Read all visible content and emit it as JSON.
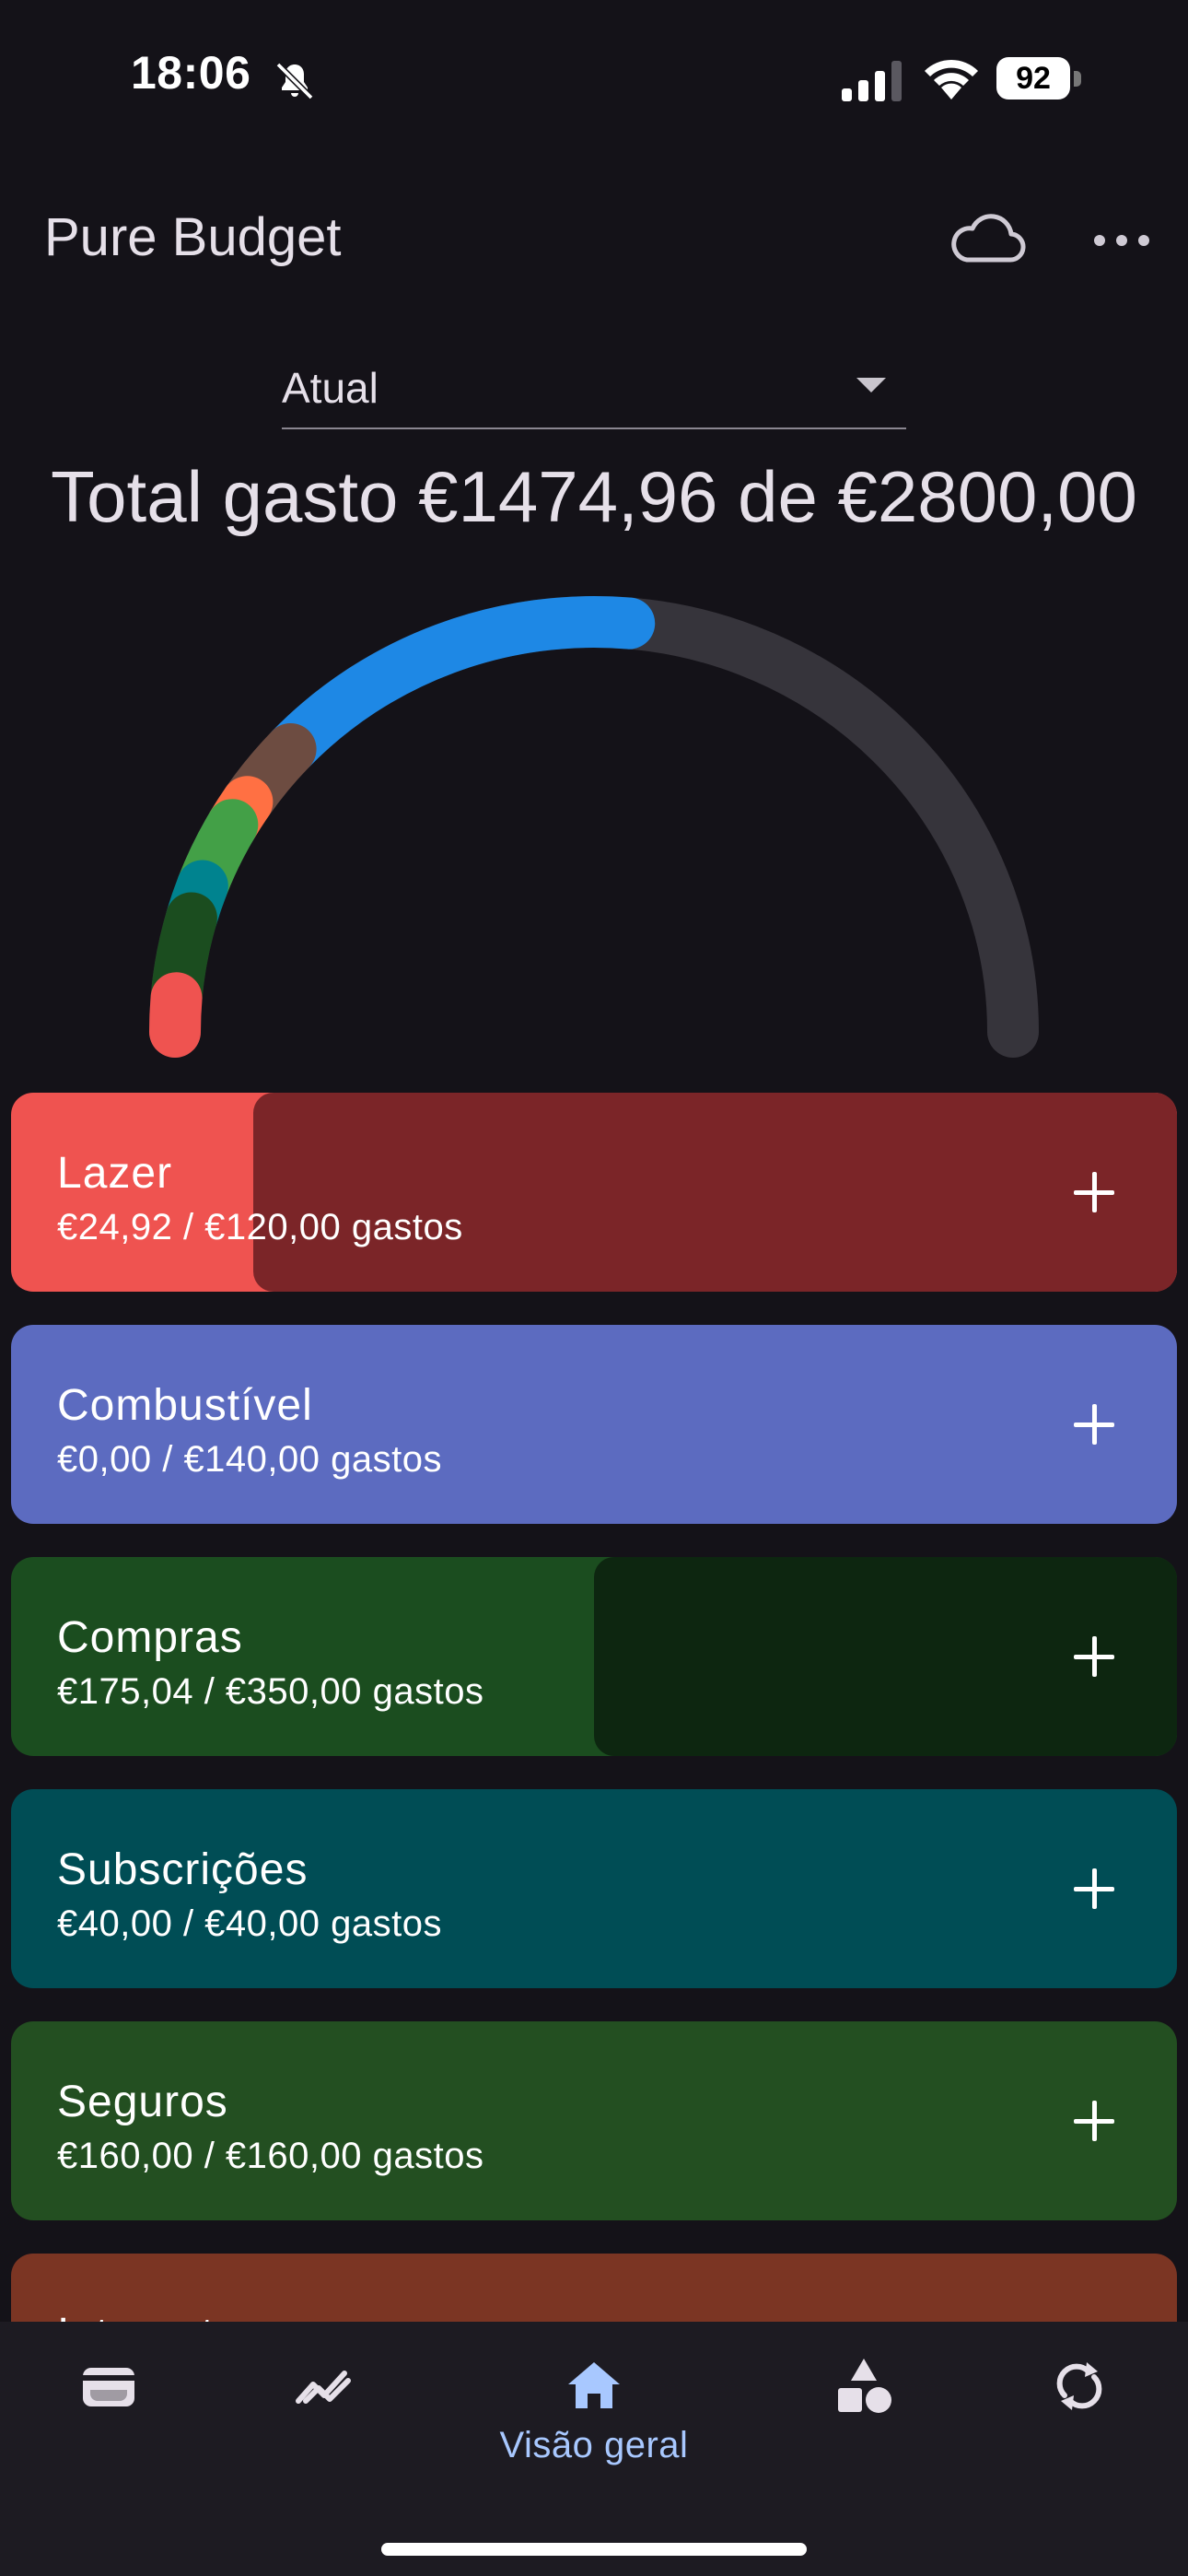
{
  "status_bar": {
    "time": "18:06",
    "battery": "92"
  },
  "app_bar": {
    "title": "Pure Budget"
  },
  "period_selector": {
    "value": "Atual"
  },
  "summary": {
    "total_text": "Total gasto €1474,96 de €2800,00"
  },
  "gauge": {
    "spent": 1474.96,
    "budget": 2800.0,
    "track_color": "#36343b",
    "segment_colors": [
      "#ef5350",
      "#1b4d1f",
      "#00838f",
      "#43a047",
      "#ff7043",
      "#6d4c41",
      "#1e88e5"
    ]
  },
  "categories": [
    {
      "name": "Lazer",
      "amount_text": "€24,92 / €120,00 gastos",
      "spent": 24.92,
      "budget": 120.0,
      "color": "#ef5350",
      "fill_color": "#7b2528"
    },
    {
      "name": "Combustível",
      "amount_text": "€0,00 / €140,00 gastos",
      "spent": 0.0,
      "budget": 140.0,
      "color": "#5c6bc0",
      "fill_color": "#2e3560"
    },
    {
      "name": "Compras",
      "amount_text": "€175,04 / €350,00 gastos",
      "spent": 175.04,
      "budget": 350.0,
      "color": "#1b4d1f",
      "fill_color": "#0d2610"
    },
    {
      "name": "Subscrições",
      "amount_text": "€40,00 / €40,00 gastos",
      "spent": 40.0,
      "budget": 40.0,
      "color": "#004d55",
      "fill_color": "#00262a"
    },
    {
      "name": "Seguros",
      "amount_text": "€160,00 / €160,00 gastos",
      "spent": 160.0,
      "budget": 160.0,
      "color": "#234f21",
      "fill_color": "#122810"
    },
    {
      "name": "Internet",
      "color": "#7b3523"
    }
  ],
  "bottom_nav": {
    "items": [
      {
        "icon": "wallet-icon"
      },
      {
        "icon": "trend-icon"
      },
      {
        "icon": "home-icon",
        "label": "Visão geral",
        "active": true
      },
      {
        "icon": "shapes-icon"
      },
      {
        "icon": "sync-icon"
      }
    ]
  }
}
